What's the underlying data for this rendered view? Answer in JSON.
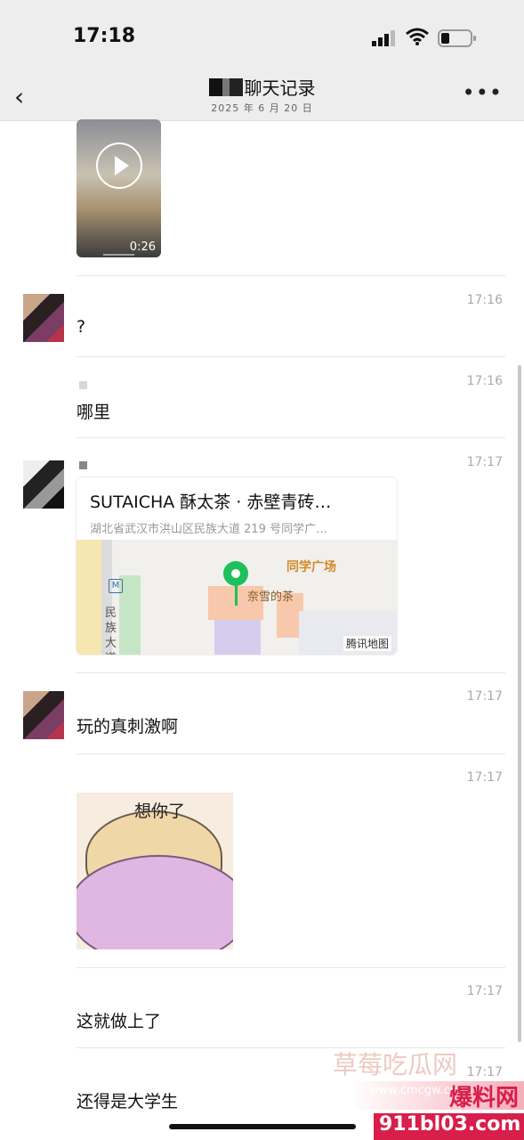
{
  "status": {
    "time": "17:18"
  },
  "header": {
    "title": "聊天记录",
    "date": "2025 年 6 月 20 日",
    "more": "•••",
    "back": "‹"
  },
  "messages": [
    {
      "type": "video",
      "duration": "0:26"
    },
    {
      "type": "text",
      "time": "17:16",
      "text": "?"
    },
    {
      "type": "text",
      "time": "17:16",
      "text": "哪里"
    },
    {
      "type": "location",
      "time": "17:17",
      "name": "SUTAICHA 酥太茶 · 赤壁青砖…",
      "address": "湖北省武汉市洪山区民族大道 219 号同学广…",
      "map": {
        "label_plaza": "同学广场",
        "label_shop": "奈雪的茶",
        "road": "民\n族\n大\n道",
        "logo": "腾讯地图",
        "metro": "M"
      }
    },
    {
      "type": "text",
      "time": "17:17",
      "text": "玩的真刺激啊"
    },
    {
      "type": "sticker",
      "time": "17:17",
      "caption": "想你了"
    },
    {
      "type": "text",
      "time": "17:17",
      "text": "这就做上了"
    },
    {
      "type": "text",
      "time": "17:17",
      "text": "还得是大学生"
    }
  ],
  "watermark": {
    "top": "草莓吃瓜网",
    "mid": "www.cmcgw.com",
    "big": "爆料网",
    "url": "911bl03.com"
  },
  "colors": {
    "bg_bar": "#ededed",
    "pin": "#1fbf5c",
    "watermark_red": "#d81e4a"
  }
}
